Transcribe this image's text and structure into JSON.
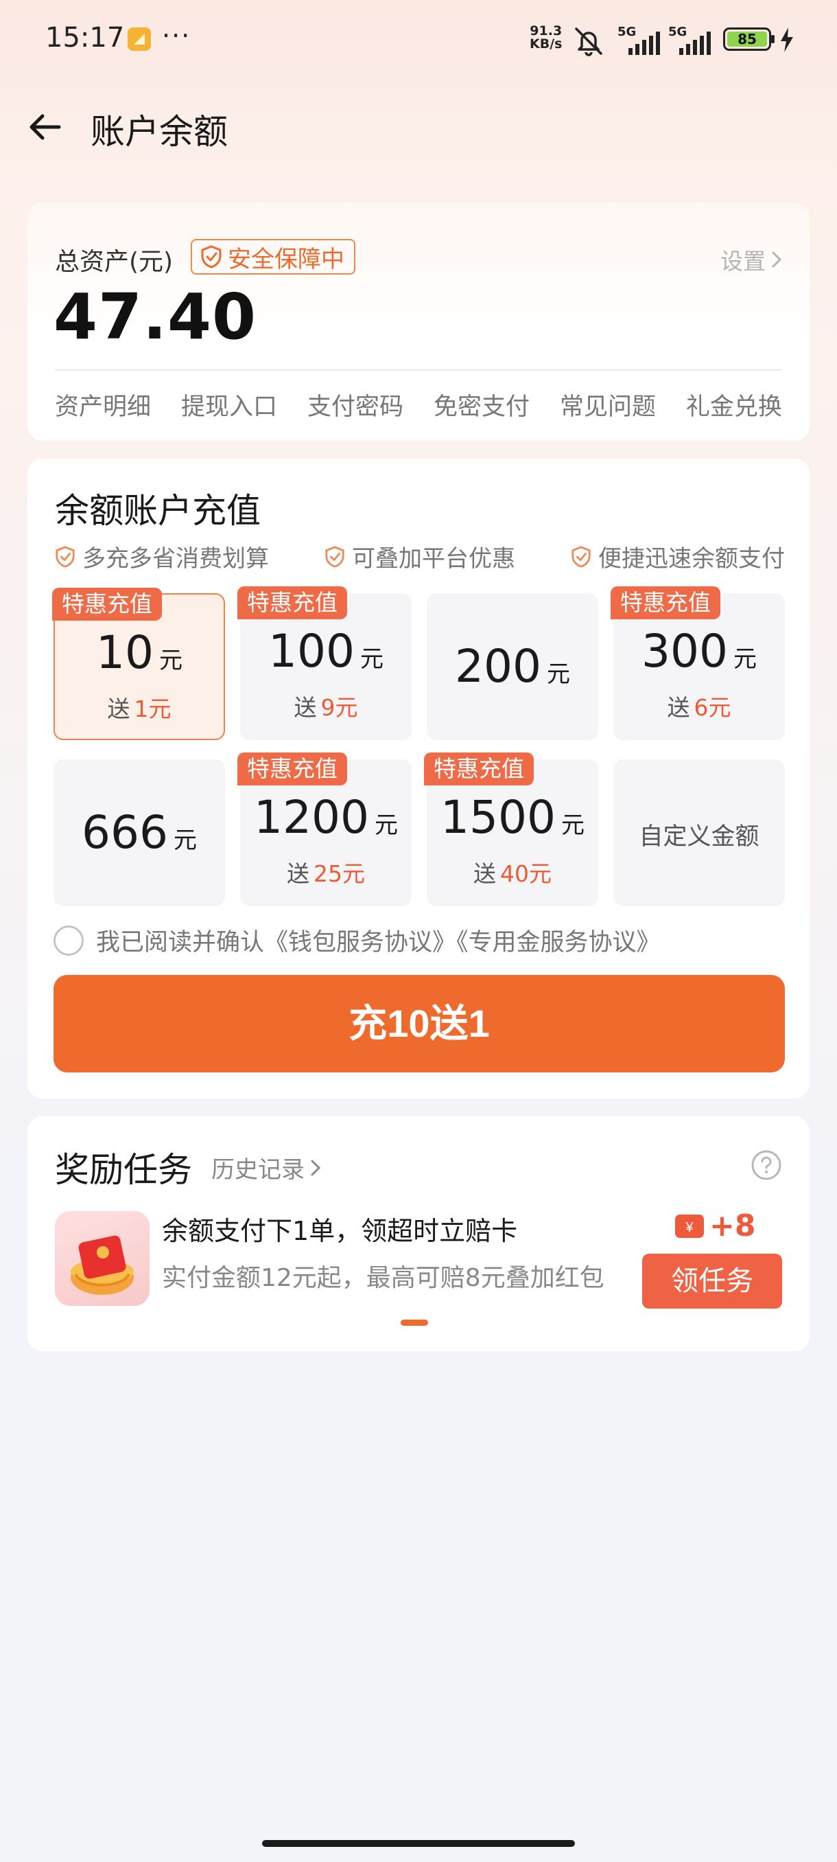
{
  "status_bar": {
    "time": "15:17",
    "more": "···",
    "net_speed_value": "91.3",
    "net_speed_unit": "KB/s",
    "signal1_label": "5G",
    "signal2_label": "5G",
    "battery_level": "85",
    "icons": [
      "app-notification-icon",
      "mute-icon",
      "signal-icon",
      "battery-icon",
      "charging-icon"
    ]
  },
  "nav": {
    "title": "账户余额",
    "back_icon": "arrow-left-icon"
  },
  "assets": {
    "label": "总资产(元)",
    "safe_badge": "安全保障中",
    "settings": "设置",
    "balance": "47.40",
    "links": [
      "资产明细",
      "提现入口",
      "支付密码",
      "免密支付",
      "常见问题",
      "礼金兑换"
    ]
  },
  "recharge": {
    "title": "余额账户充值",
    "benefits": [
      "多充多省消费划算",
      "可叠加平台优惠",
      "便捷迅速余额支付"
    ],
    "tag_label": "特惠充值",
    "unit": "元",
    "gift_prefix": "送",
    "options": [
      {
        "amount": "10",
        "gift": "1元",
        "tag": true,
        "selected": true
      },
      {
        "amount": "100",
        "gift": "9元",
        "tag": true,
        "selected": false
      },
      {
        "amount": "200",
        "gift": "",
        "tag": false,
        "selected": false
      },
      {
        "amount": "300",
        "gift": "6元",
        "tag": true,
        "selected": false
      },
      {
        "amount": "666",
        "gift": "",
        "tag": false,
        "selected": false
      },
      {
        "amount": "1200",
        "gift": "25元",
        "tag": true,
        "selected": false
      },
      {
        "amount": "1500",
        "gift": "40元",
        "tag": true,
        "selected": false
      }
    ],
    "custom_label": "自定义金额",
    "agreement_text": "我已阅读并确认《钱包服务协议》《专用金服务协议》",
    "agreement_checked": false,
    "cta_label": "充10送1"
  },
  "tasks": {
    "title": "奖励任务",
    "history": "历史记录",
    "items": [
      {
        "name": "余额支付下1单，领超时立赔卡",
        "desc": "实付金额12元起，最高可赔8元叠加红包",
        "reward": "+8",
        "button": "领任务"
      }
    ]
  },
  "colors": {
    "accent": "#ef6b2d",
    "tag": "#ef6a47",
    "gift": "#ec5a36",
    "muted": "#777777"
  }
}
